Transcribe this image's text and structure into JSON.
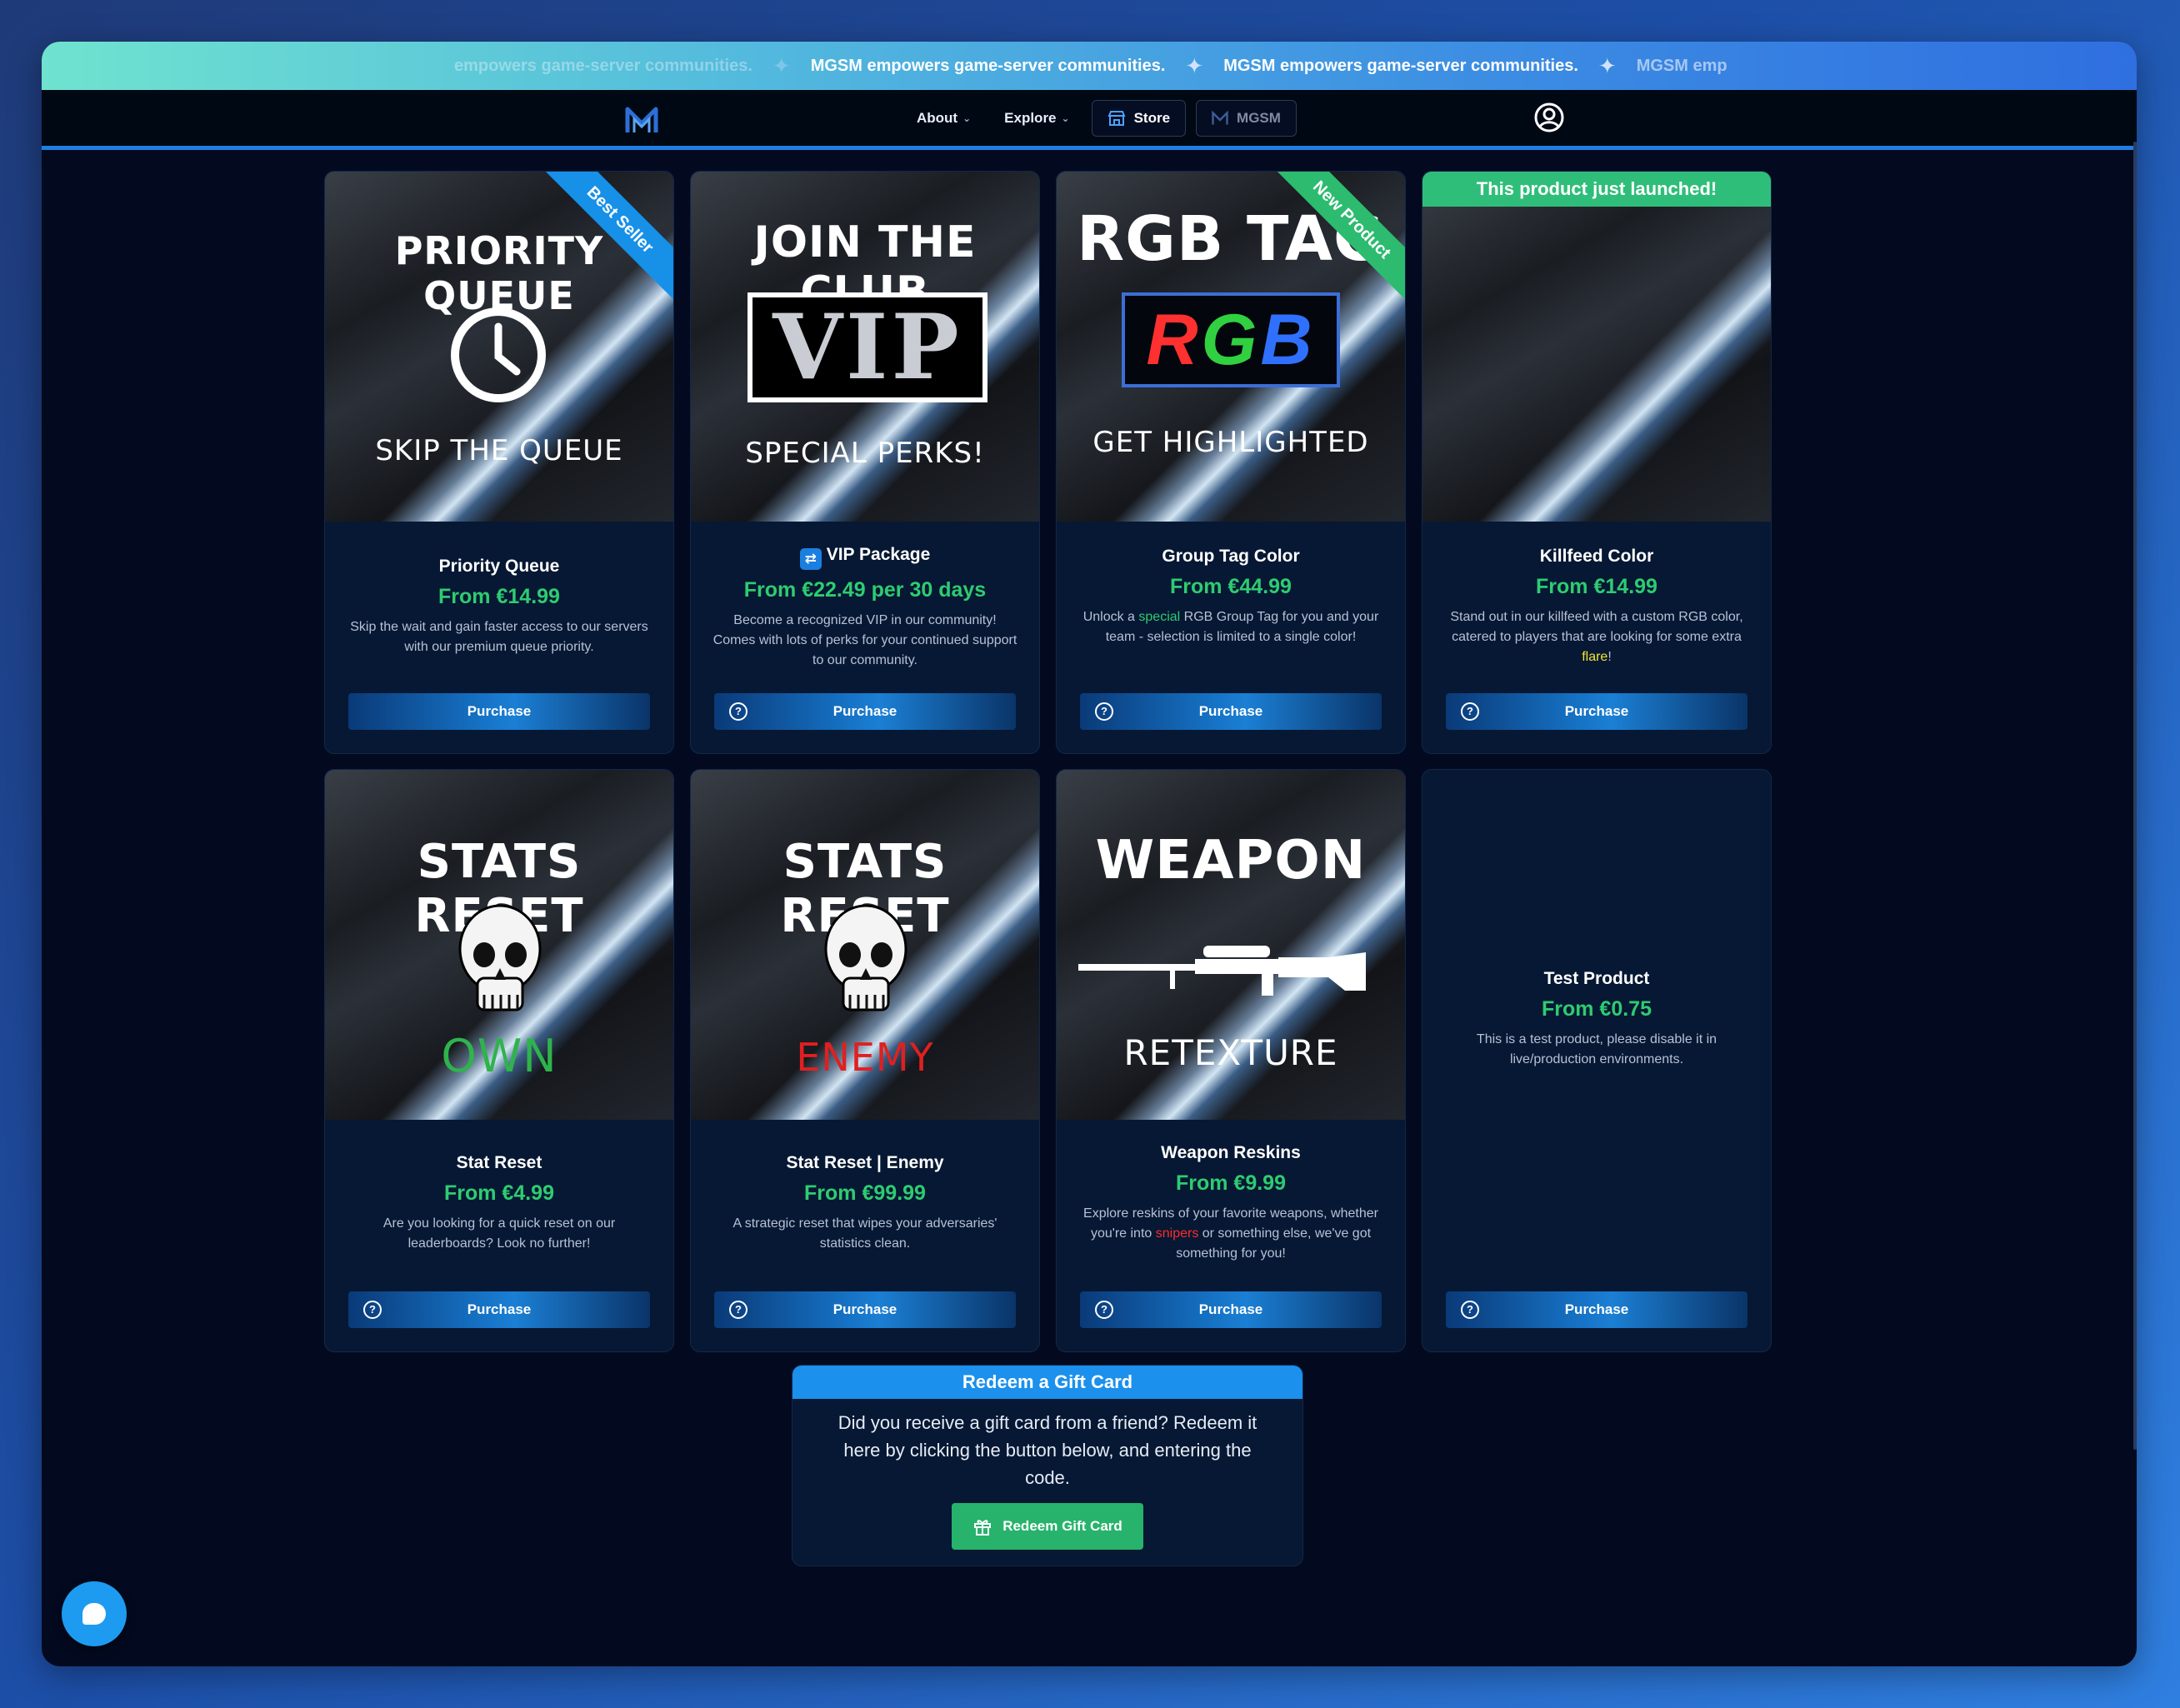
{
  "ticker": {
    "items": [
      "empowers game-server communities.",
      "MGSM empowers game-server communities.",
      "MGSM empowers game-server communities.",
      "MGSM emp"
    ]
  },
  "nav": {
    "about": "About",
    "explore": "Explore",
    "store": "Store",
    "mgsm": "MGSM"
  },
  "cards": [
    {
      "image_text_top": "PRIORITY QUEUE",
      "image_text_bottom": "SKIP THE QUEUE",
      "ribbon": "Best Seller",
      "title": "Priority Queue",
      "price": "From €14.99",
      "desc": "Skip the wait and gain faster access to our servers with our premium queue priority.",
      "button": "Purchase"
    },
    {
      "image_text_top": "JOIN THE CLUB",
      "image_text_mid": "VIP",
      "image_text_bottom": "SPECIAL PERKS!",
      "title": "VIP Package",
      "price": "From €22.49 per 30 days",
      "desc": "Become a recognized VIP in our community! Comes with lots of perks for your continued support to our community.",
      "button": "Purchase"
    },
    {
      "image_text_top": "RGB TAG",
      "image_text_mid": "RGB",
      "image_text_bottom": "GET HIGHLIGHTED",
      "ribbon": "New Product",
      "title": "Group Tag Color",
      "price": "From €44.99",
      "desc_pre": "Unlock a ",
      "desc_hl": "special",
      "desc_post": " RGB Group Tag for you and your team - selection is limited to a single color!",
      "button": "Purchase"
    },
    {
      "banner": "This product just launched!",
      "title": "Killfeed Color",
      "price": "From €14.99",
      "desc_pre": "Stand out in our killfeed with a custom RGB color, catered to players that are looking for some extra ",
      "desc_hl": "flare",
      "desc_post": "!",
      "button": "Purchase"
    },
    {
      "image_text_top": "STATS RESET",
      "image_text_bottom": "OWN",
      "title": "Stat Reset",
      "price": "From €4.99",
      "desc": "Are you looking for a quick reset on our leaderboards? Look no further!",
      "button": "Purchase"
    },
    {
      "image_text_top": "STATS RESET",
      "image_text_bottom": "ENEMY",
      "title": "Stat Reset | Enemy",
      "price": "From €99.99",
      "desc": "A strategic reset that wipes your adversaries' statistics clean.",
      "button": "Purchase"
    },
    {
      "image_text_top": "WEAPON",
      "image_text_bottom": "RETEXTURE",
      "title": "Weapon Reskins",
      "price": "From €9.99",
      "desc_pre": "Explore reskins of your favorite weapons, whether you're into ",
      "desc_hl": "snipers",
      "desc_post": " or something else, we've got something for you!",
      "button": "Purchase"
    },
    {
      "title": "Test Product",
      "price": "From €0.75",
      "desc": "This is a test product, please disable it in live/production environments.",
      "button": "Purchase"
    }
  ],
  "redeem": {
    "title": "Redeem a Gift Card",
    "text": "Did you receive a gift card from a friend? Redeem it here by clicking the button below, and entering the code.",
    "button": "Redeem Gift Card"
  },
  "colors": {
    "accent": "#1b90ec",
    "price_green": "#2ecc71",
    "background": "#030a1f"
  }
}
